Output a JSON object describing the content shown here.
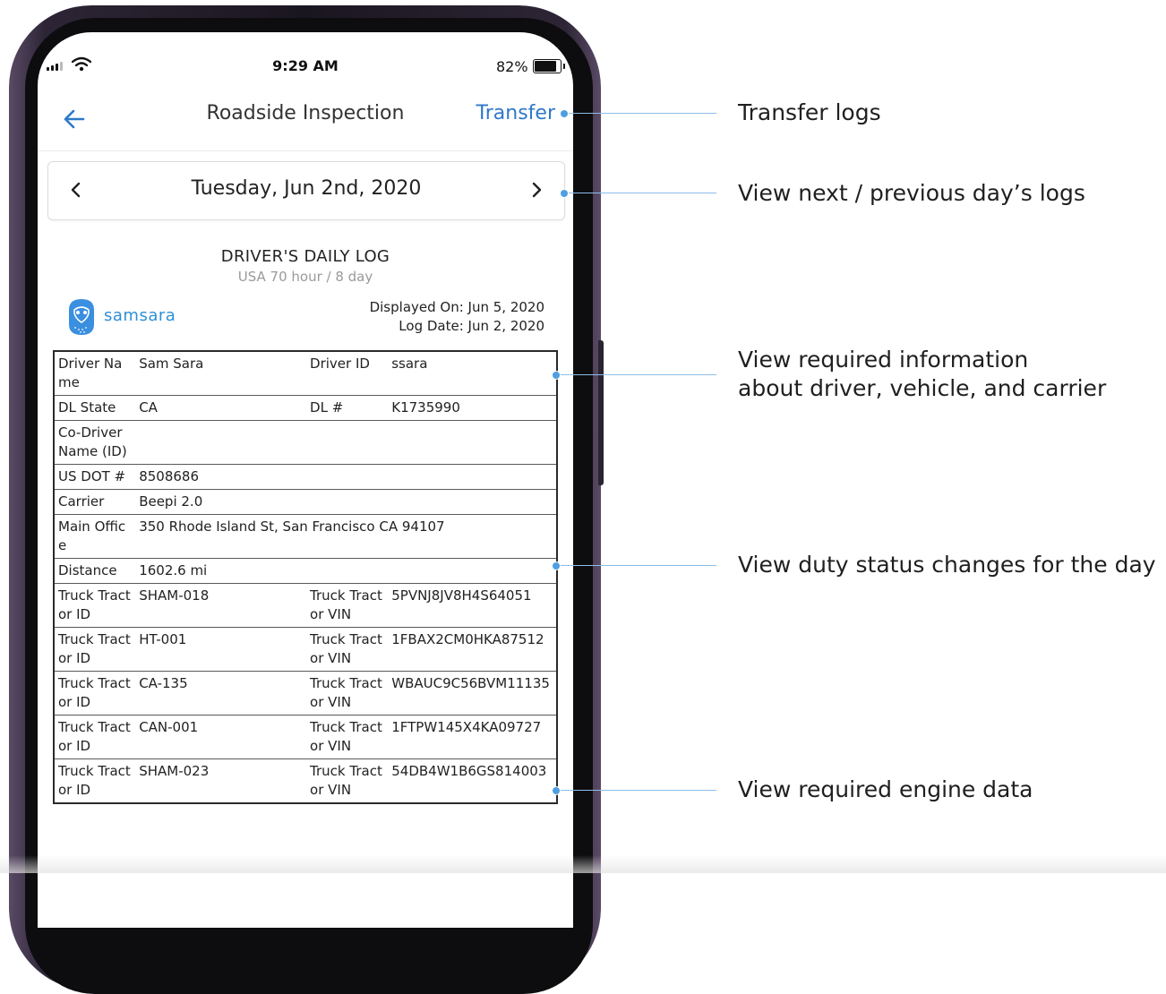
{
  "status_bar": {
    "time": "9:29 AM",
    "battery": "82%"
  },
  "nav": {
    "title": "Roadside Inspection",
    "transfer": "Transfer"
  },
  "date_selector": {
    "date": "Tuesday, Jun 2nd, 2020"
  },
  "log_header": {
    "title": "DRIVER'S DAILY LOG",
    "subtitle": "USA 70 hour / 8 day",
    "brand": "samsara",
    "displayed_on": "Displayed On: Jun 5, 2020",
    "log_date": "Log Date: Jun 2, 2020"
  },
  "table": {
    "rows": [
      [
        "Driver Name",
        "Sam Sara",
        "Driver ID",
        "ssara"
      ],
      [
        "DL State",
        "CA",
        "DL #",
        "K1735990"
      ],
      [
        "Co-Driver Name (ID)",
        "",
        "",
        ""
      ],
      [
        "US DOT #",
        "8508686",
        "",
        ""
      ],
      [
        "Carrier",
        "Beepi 2.0",
        "",
        ""
      ],
      [
        "Main Office",
        "350 Rhode Island St, San Francisco CA 94107",
        "",
        ""
      ],
      [
        "Distance",
        "1602.6 mi",
        "",
        ""
      ],
      [
        "Truck Tractor ID",
        "SHAM-018",
        "Truck Tractor VIN",
        "5PVNJ8JV8H4S64051"
      ],
      [
        "Truck Tractor ID",
        "HT-001",
        "Truck Tractor VIN",
        "1FBAX2CM0HKA87512"
      ],
      [
        "Truck Tractor ID",
        "CA-135",
        "Truck Tractor VIN",
        "WBAUC9C56BVM11135"
      ],
      [
        "Truck Tractor ID",
        "CAN-001",
        "Truck Tractor VIN",
        "1FTPW145X4KA09727"
      ],
      [
        "Truck Tractor ID",
        "SHAM-023",
        "Truck Tractor VIN",
        "54DB4W1B6GS814003"
      ]
    ]
  },
  "annotations": {
    "transfer": "Transfer logs",
    "day_nav": "View next / previous day’s logs",
    "required_info_1": "View required information",
    "required_info_2": "about driver, vehicle, and carrier",
    "duty_status": "View duty status changes for the day",
    "engine_data": "View required engine data"
  },
  "icons": [
    "signal-icon",
    "wifi-icon",
    "battery-icon",
    "back-arrow-icon",
    "chevron-left-icon",
    "chevron-right-icon",
    "samsara-owl-icon"
  ],
  "colors": {
    "accent": "#2f78c9",
    "annotation": "#4f9ee0",
    "brand": "#2f8fd6"
  }
}
